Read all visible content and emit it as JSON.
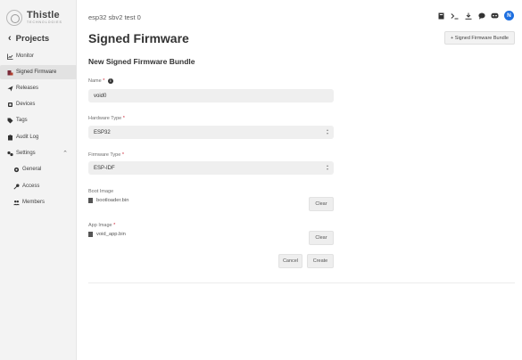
{
  "brand": {
    "name": "Thistle",
    "tagline": "TECHNOLOGIES"
  },
  "sidebar": {
    "back_label": "Projects",
    "items": [
      {
        "label": "Monitor",
        "icon": "chart-icon"
      },
      {
        "label": "Signed Firmware",
        "icon": "firmware-icon",
        "active": true
      },
      {
        "label": "Releases",
        "icon": "send-icon"
      },
      {
        "label": "Devices",
        "icon": "device-icon"
      },
      {
        "label": "Tags",
        "icon": "tag-icon"
      },
      {
        "label": "Audit Log",
        "icon": "clipboard-icon"
      },
      {
        "label": "Settings",
        "icon": "settings-icon",
        "expanded": true
      },
      {
        "label": "General",
        "icon": "gear-icon"
      },
      {
        "label": "Access",
        "icon": "key-icon"
      },
      {
        "label": "Members",
        "icon": "users-icon"
      }
    ]
  },
  "header": {
    "breadcrumb": "esp32 sbv2 test 0",
    "avatar_initial": "N",
    "avatar_color": "#1e6fe0"
  },
  "page": {
    "title": "Signed Firmware",
    "add_button": "+ Signed Firmware Bundle",
    "section_title": "New Signed Firmware Bundle"
  },
  "form": {
    "name_label": "Name",
    "name_value": "void0",
    "hardware_label": "Hardware Type",
    "hardware_value": "ESP32",
    "firmware_label": "Firmware Type",
    "firmware_value": "ESP-IDF",
    "boot_label": "Boot Image",
    "boot_file": "bootloader.bin",
    "app_label": "App Image",
    "app_file": "void_app.bin",
    "required_mark": "*",
    "clear_label": "Clear",
    "cancel_label": "Cancel",
    "create_label": "Create"
  }
}
